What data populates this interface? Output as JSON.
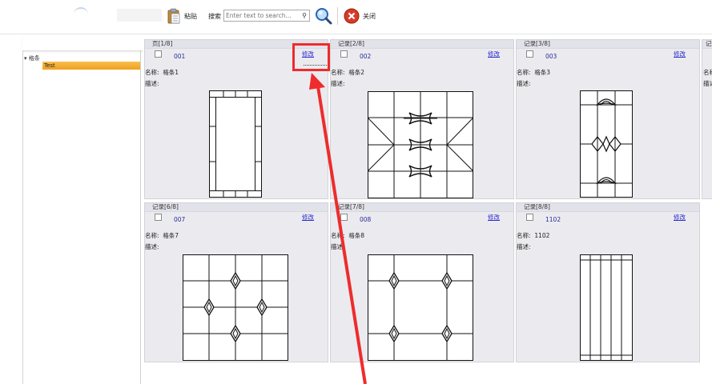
{
  "toolbar": {
    "paste_label": "粘贴",
    "search_label": "搜索",
    "search_placeholder": "Enter text to search...",
    "close_label": "关闭"
  },
  "tree": {
    "root_label": "格条",
    "selected_label": "Test"
  },
  "cards": [
    {
      "header": "页[1/8]",
      "code": "001",
      "edit": "修改",
      "name_label": "名称:",
      "name": "格条1",
      "desc_label": "描述:"
    },
    {
      "header": "记录[2/8]",
      "code": "002",
      "edit": "修改",
      "name_label": "名称:",
      "name": "格条2",
      "desc_label": "描述:"
    },
    {
      "header": "记录[3/8]",
      "code": "003",
      "edit": "修改",
      "name_label": "名称:",
      "name": "格条3",
      "desc_label": "描述:"
    },
    {
      "header": "记录[6/8]",
      "code": "007",
      "edit": "修改",
      "name_label": "名称:",
      "name": "格条7",
      "desc_label": "描述:"
    },
    {
      "header": "记录[7/8]",
      "code": "008",
      "edit": "修改",
      "name_label": "名称:",
      "name": "格条8",
      "desc_label": "描述:"
    },
    {
      "header": "记录[8/8]",
      "code": "1102",
      "edit": "修改",
      "name_label": "名称:",
      "name": "1102",
      "desc_label": "描述:"
    }
  ],
  "partial_card": {
    "header": "记",
    "name_label": "名称",
    "desc_label": "描述"
  },
  "colors": {
    "highlight": "#ee2c2c",
    "selected": "#f0a020",
    "link": "#2a2ad0"
  }
}
